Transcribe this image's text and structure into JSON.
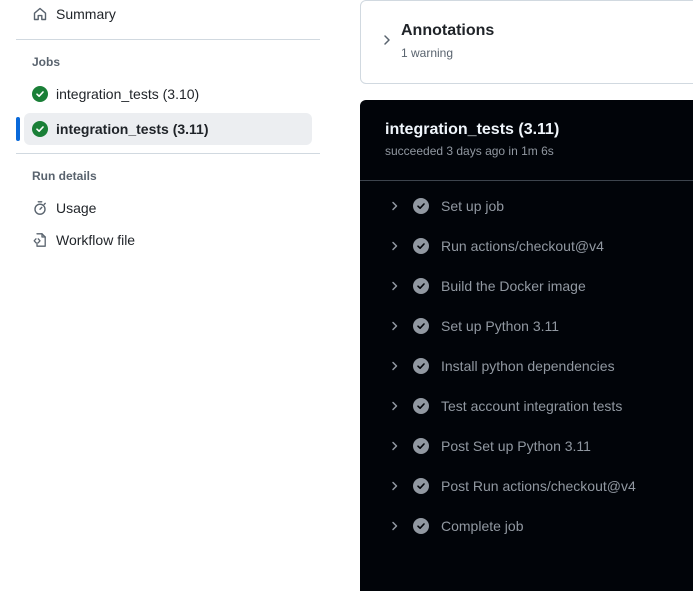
{
  "sidebar": {
    "summary_label": "Summary",
    "jobs_heading": "Jobs",
    "jobs": [
      {
        "label": "integration_tests (3.10)"
      },
      {
        "label": "integration_tests (3.11)"
      }
    ],
    "run_details_heading": "Run details",
    "usage_label": "Usage",
    "workflow_file_label": "Workflow file"
  },
  "annotations": {
    "title": "Annotations",
    "subtitle": "1 warning"
  },
  "job": {
    "title": "integration_tests (3.11)",
    "meta": "succeeded 3 days ago in 1m 6s",
    "steps": [
      {
        "label": "Set up job"
      },
      {
        "label": "Run actions/checkout@v4"
      },
      {
        "label": "Build the Docker image"
      },
      {
        "label": "Set up Python 3.11"
      },
      {
        "label": "Install python dependencies"
      },
      {
        "label": "Test account integration tests"
      },
      {
        "label": "Post Set up Python 3.11"
      },
      {
        "label": "Post Run actions/checkout@v4"
      },
      {
        "label": "Complete job"
      }
    ]
  },
  "colors": {
    "success": "#1a7f37",
    "selected_accent": "#0969da",
    "panel_bg": "#010409"
  }
}
